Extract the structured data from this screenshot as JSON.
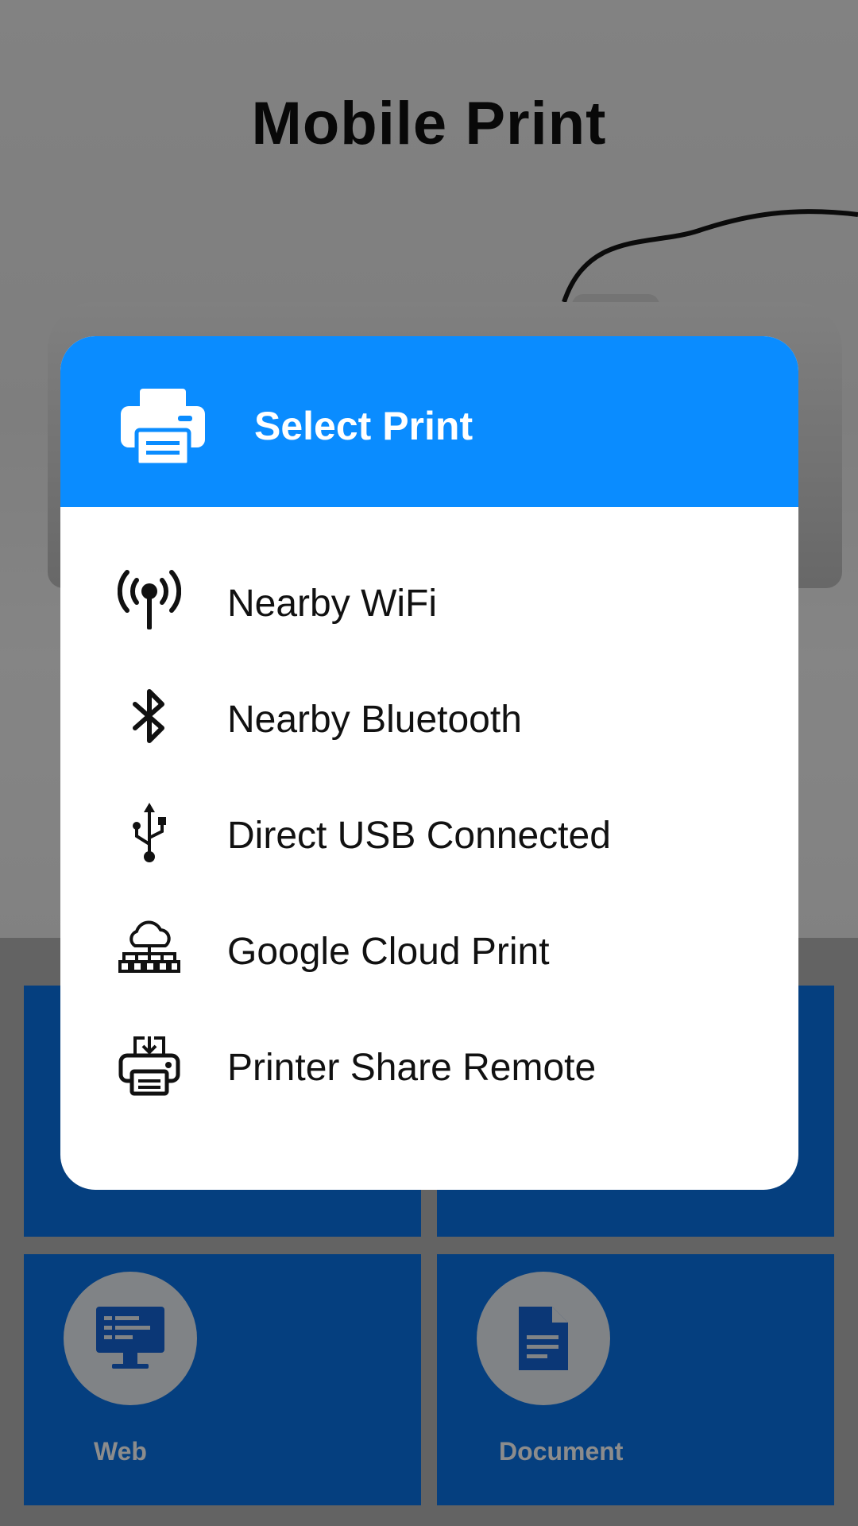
{
  "app": {
    "title": "Mobile Print"
  },
  "dialog": {
    "title": "Select Print",
    "header_icon": "printer-icon",
    "options": [
      {
        "label": "Nearby WiFi",
        "icon": "wifi-antenna-icon"
      },
      {
        "label": "Nearby Bluetooth",
        "icon": "bluetooth-icon"
      },
      {
        "label": "Direct USB Connected",
        "icon": "usb-icon"
      },
      {
        "label": "Google Cloud Print",
        "icon": "cloud-network-icon"
      },
      {
        "label": "Printer Share Remote",
        "icon": "printer-share-icon"
      }
    ]
  },
  "grid": {
    "tiles": [
      {
        "label": "",
        "icon": ""
      },
      {
        "label": "",
        "icon": ""
      },
      {
        "label": "Web",
        "icon": "monitor-icon"
      },
      {
        "label": "Document",
        "icon": "document-icon"
      }
    ]
  },
  "colors": {
    "dialog_header": "#0a8cff",
    "tile": "#0a73e8",
    "scrim": "rgba(0,0,0,0.45)"
  }
}
